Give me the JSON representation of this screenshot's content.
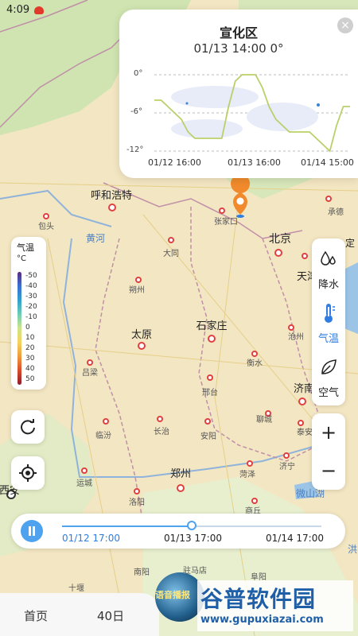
{
  "status_bar": {
    "time": "4:09"
  },
  "map_labels": {
    "cities": [
      "呼和浩特",
      "北京",
      "张家口",
      "大同",
      "朔州",
      "太原",
      "石家庄",
      "吕梁",
      "邢台",
      "衡水",
      "沧州",
      "长治",
      "安阳",
      "临汾",
      "济南",
      "聊城",
      "郑州",
      "洛阳",
      "运城",
      "菏泽",
      "济宁",
      "商丘",
      "南阳",
      "驻马店",
      "阜阳",
      "泰安",
      "天津",
      "承德",
      "包头",
      "十堰",
      "微山湖",
      "黄河",
      "西安",
      "洪",
      "定"
    ]
  },
  "popup": {
    "location": "宣化区",
    "reading": "01/13 14:00 0°",
    "chart_data": {
      "type": "line",
      "y_ticks": [
        "0°",
        "-6°",
        "-12°"
      ],
      "ylim": [
        -12,
        0
      ],
      "x_ticks": [
        "01/12 16:00",
        "01/13 16:00",
        "01/14 15:00"
      ],
      "values": [
        -4,
        -4,
        -5,
        -6,
        -7,
        -9,
        -10,
        -10,
        -10,
        -10,
        -10,
        -5,
        -1,
        0,
        0,
        0,
        -2,
        -5,
        -7,
        -8,
        -9,
        -9,
        -9,
        -9,
        -10,
        -11,
        -12,
        -8,
        -5,
        -5
      ]
    }
  },
  "legend": {
    "title": "气温",
    "unit": "°C",
    "ticks": [
      "-50",
      "-40",
      "-30",
      "-20",
      "-10",
      "0",
      "10",
      "20",
      "30",
      "40",
      "50"
    ]
  },
  "layers": [
    {
      "label": "降水",
      "icon": "raindrop-icon",
      "active": false
    },
    {
      "label": "气温",
      "icon": "thermometer-icon",
      "active": true
    },
    {
      "label": "空气",
      "icon": "leaf-icon",
      "active": false
    }
  ],
  "zoom": {
    "in": "+",
    "out": "−"
  },
  "timeline": {
    "labels": [
      "01/12 17:00",
      "01/13 17:00",
      "01/14 17:00"
    ],
    "progress": 0.5
  },
  "bottom_nav": {
    "home": "首页",
    "forecast": "40日",
    "voice": "语音播报"
  },
  "watermark": {
    "brand": "谷普软件园",
    "url": "www.gupuxiazai.com"
  },
  "colors": {
    "accent": "#4fa3ee",
    "pin": "#f08a2c",
    "city_dot": "#e04040"
  }
}
